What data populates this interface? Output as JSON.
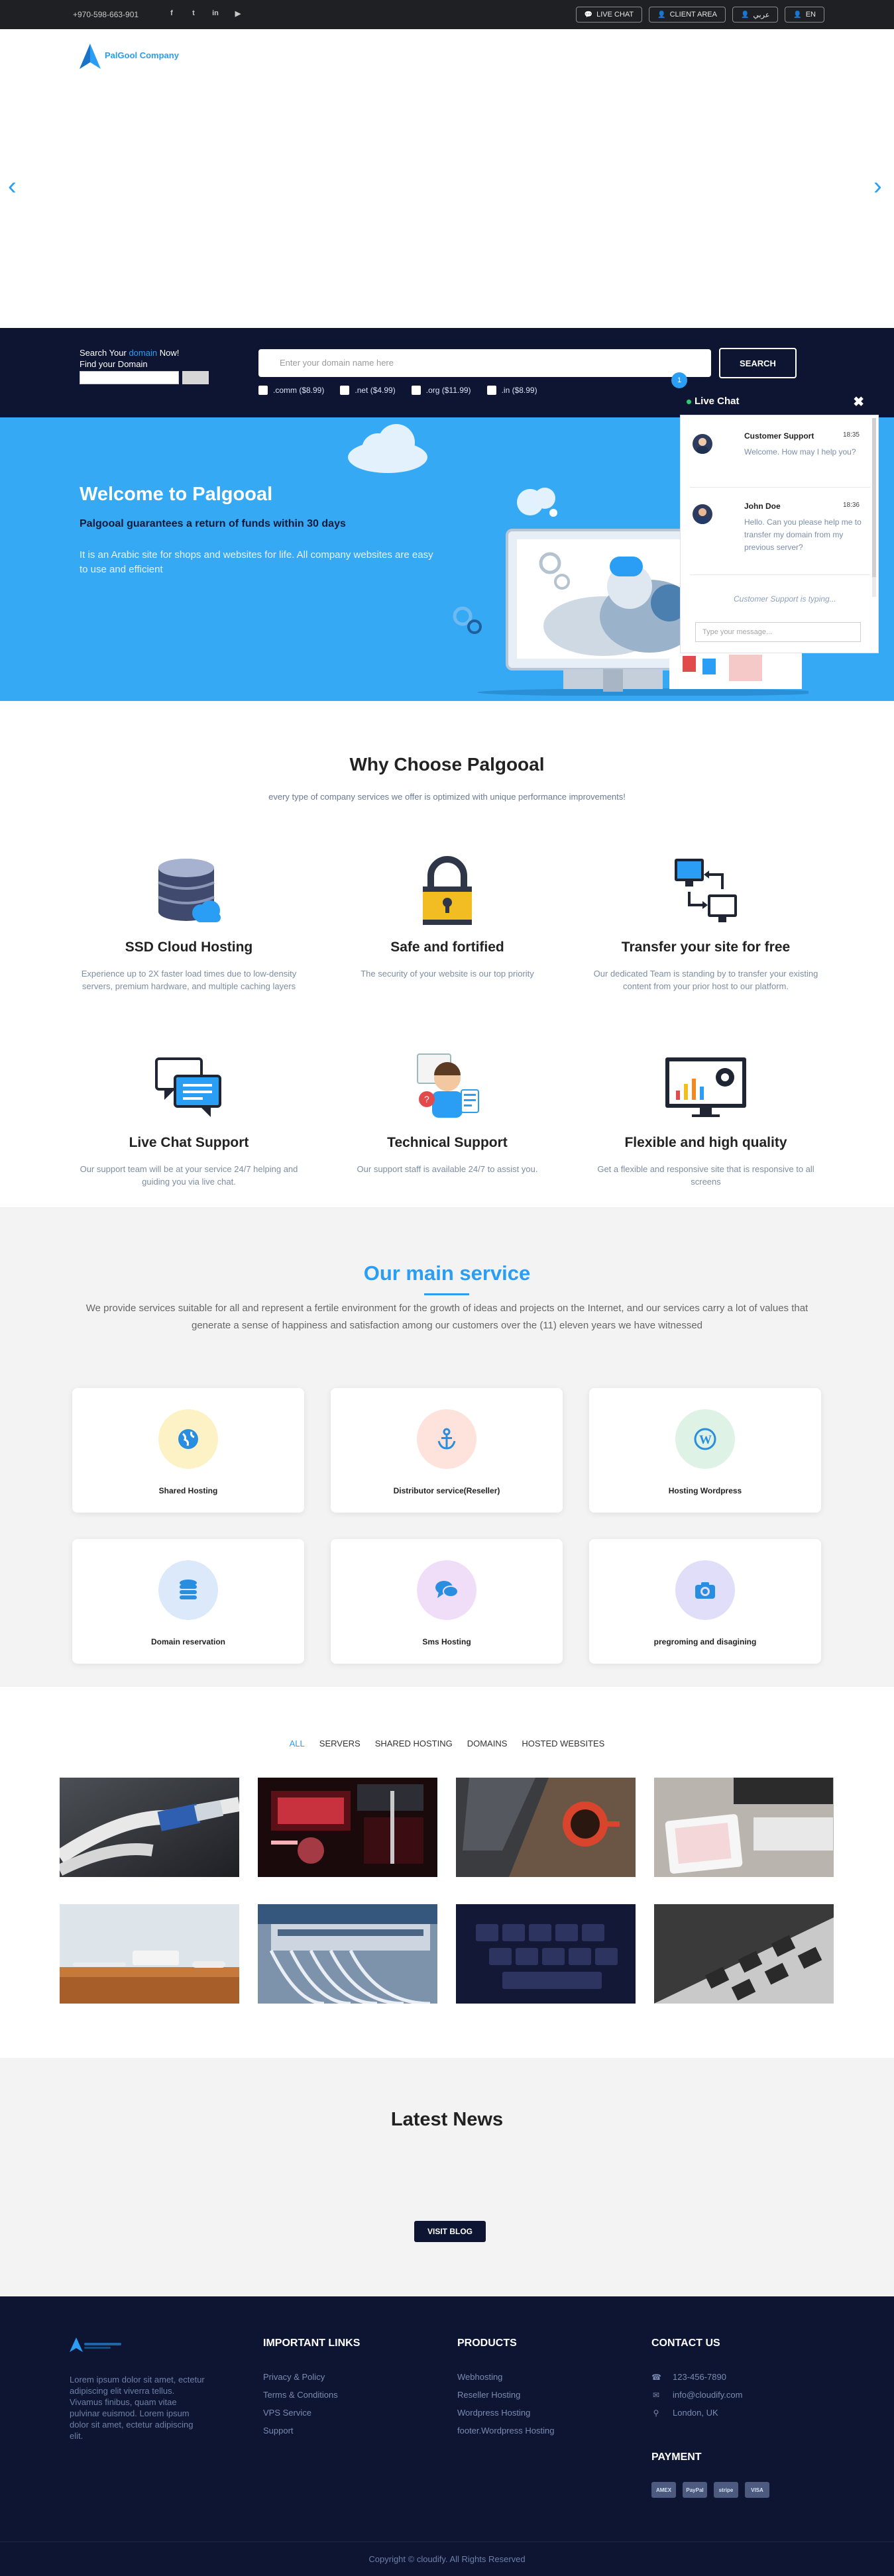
{
  "topbar": {
    "phone": "+970-598-663-901",
    "social": [
      {
        "icon": "facebook-icon",
        "glyph": "f"
      },
      {
        "icon": "twitter-icon",
        "glyph": "t"
      },
      {
        "icon": "linkedin-icon",
        "glyph": "in"
      },
      {
        "icon": "youtube-icon",
        "glyph": "▶"
      }
    ],
    "buttons": [
      {
        "icon": "chat-icon",
        "label": "Live Chat"
      },
      {
        "icon": "user-icon",
        "label": "Client Area"
      },
      {
        "icon": "user-icon",
        "label": "عربي"
      },
      {
        "icon": "user-icon",
        "label": "EN"
      }
    ]
  },
  "header": {
    "logo_text": "PalGool Company"
  },
  "slider": {
    "prev": "‹",
    "next": "›"
  },
  "domain": {
    "label_prefix": "Search Your ",
    "label_highlight": "domain",
    "label_suffix": " Now!",
    "label2": "Find your Domain",
    "placeholder": "Enter your domain name here",
    "button": "Search",
    "tlds": [
      ".comm ($8.99)",
      ".net ($4.99)",
      ".org ($11.99)",
      ".in ($8.99)"
    ]
  },
  "welcome": {
    "title": "Welcome to Palgooal",
    "subtitle": "Palgooal guarantees a return of funds within 30 days",
    "description": "It is an Arabic site for shops and websites for life. All company websites are easy to use and efficient"
  },
  "chat": {
    "badge": "1",
    "title": "Live Chat",
    "close": "✖",
    "messages": [
      {
        "name": "Customer Support",
        "time": "18:35",
        "text": "Welcome. How may I help you?"
      },
      {
        "name": "John Doe",
        "time": "18:36",
        "text": "Hello. Can you please help me to transfer my domain from my previous server?"
      }
    ],
    "typing": "Customer Support is typing...",
    "input_placeholder": "Type your message..."
  },
  "why": {
    "title": "Why Choose Palgooal",
    "subtitle": "every type of company services we offer is optimized with unique performance improvements!",
    "features": [
      {
        "icon": "database-cloud-icon",
        "title": "SSD Cloud Hosting",
        "text": "Experience up to 2X faster load times due to low-density servers, premium hardware, and multiple caching layers"
      },
      {
        "icon": "padlock-icon",
        "title": "Safe and fortified",
        "text": "The security of your website is our top priority"
      },
      {
        "icon": "transfer-computers-icon",
        "title": "Transfer your site for free",
        "text": "Our dedicated Team is standing by to transfer your existing content from your prior host to our platform."
      },
      {
        "icon": "chat-bubbles-icon",
        "title": "Live Chat Support",
        "text": "Our support team will be at your service 24/7 helping and guiding you via live chat."
      },
      {
        "icon": "support-agent-icon",
        "title": "Technical Support",
        "text": "Our support staff is available 24/7 to assist you."
      },
      {
        "icon": "monitor-chart-icon",
        "title": "Flexible and high quality",
        "text": "Get a flexible and responsive site that is responsive to all screens"
      }
    ]
  },
  "services": {
    "title": "Our main service",
    "description": "We provide services suitable for all and represent a fertile environment for the growth of ideas and projects on the Internet, and our services carry a lot of values that generate a sense of happiness and satisfaction among our customers over the (11) eleven years we have witnessed",
    "items": [
      {
        "icon": "globe-icon",
        "label": "Shared Hosting",
        "bg": "#fdf2c6",
        "fg": "#2a8ee0"
      },
      {
        "icon": "anchor-icon",
        "label": "Distributor service(Reseller)",
        "bg": "#fde3dc",
        "fg": "#2a8ee0"
      },
      {
        "icon": "wordpress-icon",
        "label": "Hosting Wordpress",
        "bg": "#def3e6",
        "fg": "#2a8ee0"
      },
      {
        "icon": "database-icon",
        "label": "Domain reservation",
        "bg": "#dce9fb",
        "fg": "#2a8ee0"
      },
      {
        "icon": "sms-chat-icon",
        "label": "Sms Hosting",
        "bg": "#f0def8",
        "fg": "#2a8ee0"
      },
      {
        "icon": "camera-icon",
        "label": "pregroming and disagining",
        "bg": "#e1defa",
        "fg": "#2a8ee0"
      }
    ]
  },
  "portfolio": {
    "filters": [
      "All",
      "Servers",
      "Shared Hosting",
      "Domains",
      "Hosted Websites"
    ],
    "active_filter": "All"
  },
  "news": {
    "title": "Latest News",
    "button": "Visit Blog"
  },
  "footer": {
    "about": "Lorem ipsum dolor sit amet, ectetur adipiscing elit viverra tellus. Vivamus finibus, quam vitae pulvinar euismod. Lorem ipsum dolor sit amet, ectetur adipiscing elit.",
    "links": {
      "title": "Important Links",
      "items": [
        "Privacy & Policy",
        "Terms & Conditions",
        "VPS Service",
        "Support"
      ]
    },
    "products": {
      "title": "Products",
      "items": [
        "Webhosting",
        "Reseller Hosting",
        "Wordpress Hosting",
        "footer.Wordpress Hosting"
      ]
    },
    "contact": {
      "title": "Contact Us",
      "items": [
        {
          "icon": "phone-icon",
          "text": "123-456-7890"
        },
        {
          "icon": "mail-icon",
          "text": "info@cloudify.com"
        },
        {
          "icon": "location-icon",
          "text": "London, UK"
        }
      ]
    },
    "payment": {
      "title": "Payment",
      "cards": [
        "AMEX",
        "PayPal",
        "stripe",
        "VISA"
      ]
    },
    "copyright": "Copyright © cloudify. All Rights Reserved"
  }
}
